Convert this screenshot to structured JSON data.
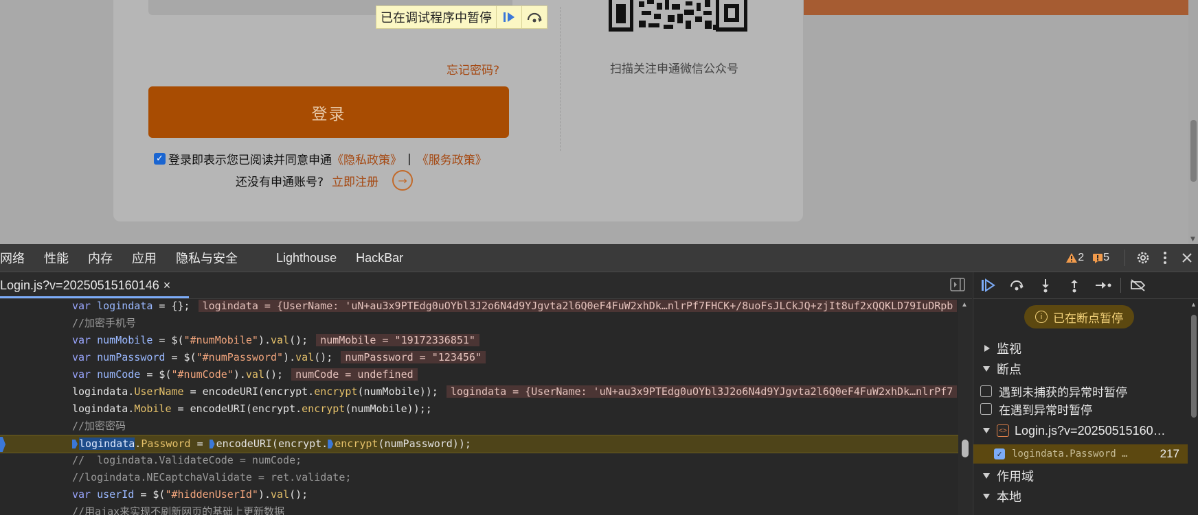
{
  "page": {
    "paused_banner": "已在调试程序中暂停",
    "forgot_password": "忘记密码?",
    "login_button": "登录",
    "agreement_text": "登录即表示您已阅读并同意申通",
    "privacy_policy": "《隐私政策》",
    "separator": "|",
    "service_policy": "《服务政策》",
    "no_account": "还没有申通账号?",
    "register_now": "立即注册",
    "qr_caption": "扫描关注申通微信公众号"
  },
  "devtools": {
    "tabs": [
      "网络",
      "性能",
      "内存",
      "应用",
      "隐私与安全",
      "Lighthouse",
      "HackBar"
    ],
    "warnings_count": "2",
    "errors_count": "5",
    "file_tab": "Login.js?v=20250515160146",
    "code_lines": [
      {
        "parts": [
          [
            "kw",
            "var "
          ],
          [
            "vr",
            "logindata"
          ],
          [
            "tx",
            " = {};"
          ]
        ],
        "inline": "logindata = {UserName: 'uN+au3x9PTEdg0uOYbl3J2o6N4d9YJgvta2l6Q0eF4FuW2xhDk…nlrPf7FHCK+/8uoFsJLCkJQ+zjIt8uf2xQQKLD79IuDRpb"
      },
      {
        "parts": [
          [
            "cm",
            "//加密手机号"
          ]
        ]
      },
      {
        "parts": [
          [
            "kw",
            "var "
          ],
          [
            "vr",
            "numMobile"
          ],
          [
            "tx",
            " = $("
          ],
          [
            "st",
            "\"#numMobile\""
          ],
          [
            "tx",
            ")."
          ],
          [
            "pr",
            "val"
          ],
          [
            "tx",
            "();"
          ]
        ],
        "inline": "numMobile = \"19172336851\""
      },
      {
        "parts": [
          [
            "kw",
            "var "
          ],
          [
            "vr",
            "numPassword"
          ],
          [
            "tx",
            " = $("
          ],
          [
            "st",
            "\"#numPassword\""
          ],
          [
            "tx",
            ")."
          ],
          [
            "pr",
            "val"
          ],
          [
            "tx",
            "();"
          ]
        ],
        "inline": "numPassword = \"123456\""
      },
      {
        "parts": [
          [
            "kw",
            "var "
          ],
          [
            "vr",
            "numCode"
          ],
          [
            "tx",
            " = $("
          ],
          [
            "st",
            "\"#numCode\""
          ],
          [
            "tx",
            ")."
          ],
          [
            "pr",
            "val"
          ],
          [
            "tx",
            "();"
          ]
        ],
        "inline": "numCode = undefined"
      },
      {
        "parts": [
          [
            "tx",
            "logindata."
          ],
          [
            "pr",
            "UserName"
          ],
          [
            "tx",
            " = encodeURI(encrypt."
          ],
          [
            "pr",
            "encrypt"
          ],
          [
            "tx",
            "(numMobile));"
          ]
        ],
        "inline": "logindata = {UserName: 'uN+au3x9PTEdg0uOYbl3J2o6N4d9YJgvta2l6Q0eF4FuW2xhDk…nlrPf7"
      },
      {
        "parts": [
          [
            "tx",
            "logindata."
          ],
          [
            "pr",
            "Mobile"
          ],
          [
            "tx",
            " = encodeURI(encrypt."
          ],
          [
            "pr",
            "encrypt"
          ],
          [
            "tx",
            "(numMobile));;"
          ]
        ]
      },
      {
        "parts": [
          [
            "cm",
            "//加密密码"
          ]
        ]
      },
      {
        "current": true
      },
      {
        "parts": [
          [
            "cm",
            "//  logindata.ValidateCode = numCode;"
          ]
        ]
      },
      {
        "parts": [
          [
            "cm",
            "//logindata.NECaptchaValidate = ret.validate;"
          ]
        ]
      },
      {
        "parts": [
          [
            "kw",
            "var "
          ],
          [
            "vr",
            "userId"
          ],
          [
            "tx",
            " = $("
          ],
          [
            "st",
            "\"#hiddenUserId\""
          ],
          [
            "tx",
            ")."
          ],
          [
            "pr",
            "val"
          ],
          [
            "tx",
            "();"
          ]
        ]
      },
      {
        "parts": [
          [
            "cm",
            "//用ajax来实现不刷新网页的基础上更新数据"
          ]
        ]
      }
    ],
    "current_line": {
      "selected": "logindata",
      "prop": "Password",
      "mid": " = ",
      "fn": "encodeURI(encrypt.",
      "method": "encrypt",
      "tail": "(numPassword));"
    },
    "sidebar": {
      "paused_status": "已在断点暂停",
      "watch": "监视",
      "breakpoints": "断点",
      "pause_uncaught": "遇到未捕获的异常时暂停",
      "pause_caught": "在遇到异常时暂停",
      "bp_file": "Login.js?v=20250515160…",
      "bp_code": "logindata.Password …",
      "bp_line": "217",
      "scope": "作用域",
      "local": "本地"
    }
  }
}
